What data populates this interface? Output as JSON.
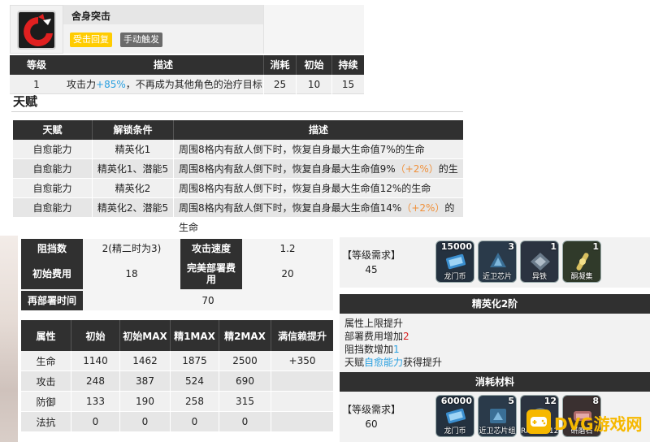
{
  "skill": {
    "name": "舍身突击",
    "tags": [
      "受击回复",
      "手动触发"
    ],
    "headers": [
      "等级",
      "描述",
      "消耗",
      "初始",
      "持续"
    ],
    "row": {
      "level": "1",
      "desc_prefix": "攻击力",
      "desc_bonus": "+85%",
      "desc_suffix": "，不再成为其他角色的治疗目标",
      "cost": "25",
      "init": "10",
      "duration": "15"
    },
    "colors": {
      "tag_yellow": "#ffcc00",
      "tag_gray": "#6b6b6b",
      "icon_red": "#e02020"
    }
  },
  "talent": {
    "title": "天赋",
    "headers": [
      "天赋",
      "解锁条件",
      "描述"
    ],
    "rows": [
      {
        "name": "自愈能力",
        "cond": "精英化1",
        "desc": "周围8格内有敌人倒下时，恢复自身最大生命值7%的生命",
        "bonus": "",
        "tail": ""
      },
      {
        "name": "自愈能力",
        "cond": "精英化1、潜能5",
        "desc": "周围8格内有敌人倒下时，恢复自身最大生命值9%",
        "bonus": "（+2%）",
        "tail": "的生命"
      },
      {
        "name": "自愈能力",
        "cond": "精英化2",
        "desc": "周围8格内有敌人倒下时，恢复自身最大生命值12%的生命",
        "bonus": "",
        "tail": ""
      },
      {
        "name": "自愈能力",
        "cond": "精英化2、潜能5",
        "desc": "周围8格内有敌人倒下时，恢复自身最大生命值14%",
        "bonus": "（+2%）",
        "tail": "的生命"
      }
    ]
  },
  "info": {
    "block_label": "阻挡数",
    "block_value": "2(精二时为3)",
    "atk_speed_label": "攻击速度",
    "atk_speed_value": "1.2",
    "init_cost_label": "初始费用",
    "init_cost_value": "18",
    "perfect_cost_label": "完美部署费用",
    "perfect_cost_value": "20",
    "redeploy_label": "再部署时间",
    "redeploy_value": "70"
  },
  "stats": {
    "headers": [
      "属性",
      "初始",
      "初始MAX",
      "精1MAX",
      "精2MAX",
      "满信赖提升"
    ],
    "rows": [
      [
        "生命",
        "1140",
        "1462",
        "1875",
        "2500",
        "+350"
      ],
      [
        "攻击",
        "248",
        "387",
        "524",
        "690",
        ""
      ],
      [
        "防御",
        "133",
        "190",
        "258",
        "315",
        ""
      ],
      [
        "法抗",
        "0",
        "0",
        "0",
        "0",
        ""
      ]
    ]
  },
  "right": {
    "req_label": "【等级需求】",
    "elite1": {
      "level": "45",
      "materials": [
        {
          "count": "15000",
          "name": "龙门币",
          "icon": "lmd-icon"
        },
        {
          "count": "3",
          "name": "近卫芯片",
          "icon": "chip-icon"
        },
        {
          "count": "1",
          "name": "异铁",
          "icon": "iron-icon"
        },
        {
          "count": "1",
          "name": "酮凝集",
          "icon": "ketone-icon"
        }
      ]
    },
    "elite2_title": "精英化2阶",
    "elite2_lines": {
      "l1": "属性上限提升",
      "l2_prefix": "部署费用增加",
      "l2_value": "2",
      "l3_prefix": "阻挡数增加",
      "l3_value": "1",
      "l4_prefix": "天赋",
      "l4_link": "自愈能力",
      "l4_suffix": "获得提升"
    },
    "materials_title": "消耗材料",
    "elite2": {
      "level": "60",
      "materials": [
        {
          "count": "60000",
          "name": "龙门币",
          "icon": "lmd-icon"
        },
        {
          "count": "5",
          "name": "近卫芯片组",
          "icon": "chip-pack-icon"
        },
        {
          "count": "12",
          "name": "RMA70-12",
          "icon": "rma-icon"
        },
        {
          "count": "8",
          "name": "研磨石",
          "icon": "grindstone-icon"
        }
      ]
    }
  },
  "watermark": "DVG游戏网"
}
